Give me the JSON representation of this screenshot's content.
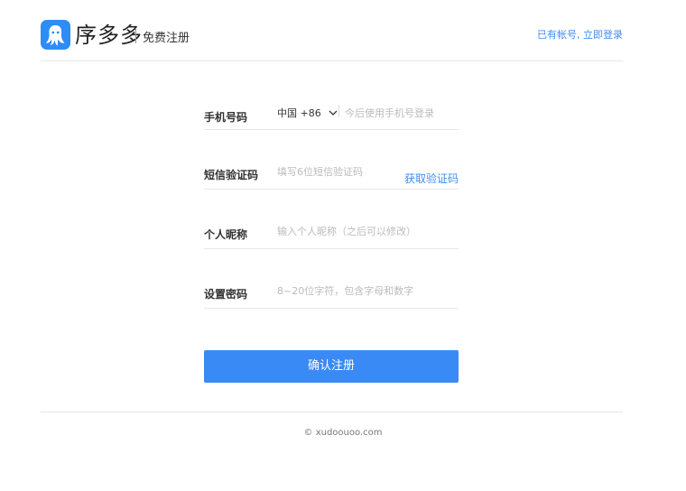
{
  "header": {
    "logo_text": "序多多",
    "title": "免费注册",
    "login_link": "已有帐号, 立即登录"
  },
  "form": {
    "phone": {
      "label": "手机号码",
      "country": "中国 +86",
      "placeholder": "今后使用手机号登录"
    },
    "sms": {
      "label": "短信验证码",
      "placeholder": "填写6位短信验证码",
      "action": "获取验证码"
    },
    "nickname": {
      "label": "个人昵称",
      "placeholder": "输入个人昵称（之后可以修改）"
    },
    "password": {
      "label": "设置密码",
      "placeholder": "8~20位字符，包含字母和数字"
    },
    "submit": "确认注册"
  },
  "footer": {
    "copyright": "© xudoouoo.com"
  },
  "colors": {
    "accent": "#3a8af6",
    "link": "#3f8ef5",
    "logo_bg": "#2f8cf7"
  },
  "icons": {
    "logo": "octopus-logo-icon",
    "country_dropdown": "chevron-down-icon"
  }
}
